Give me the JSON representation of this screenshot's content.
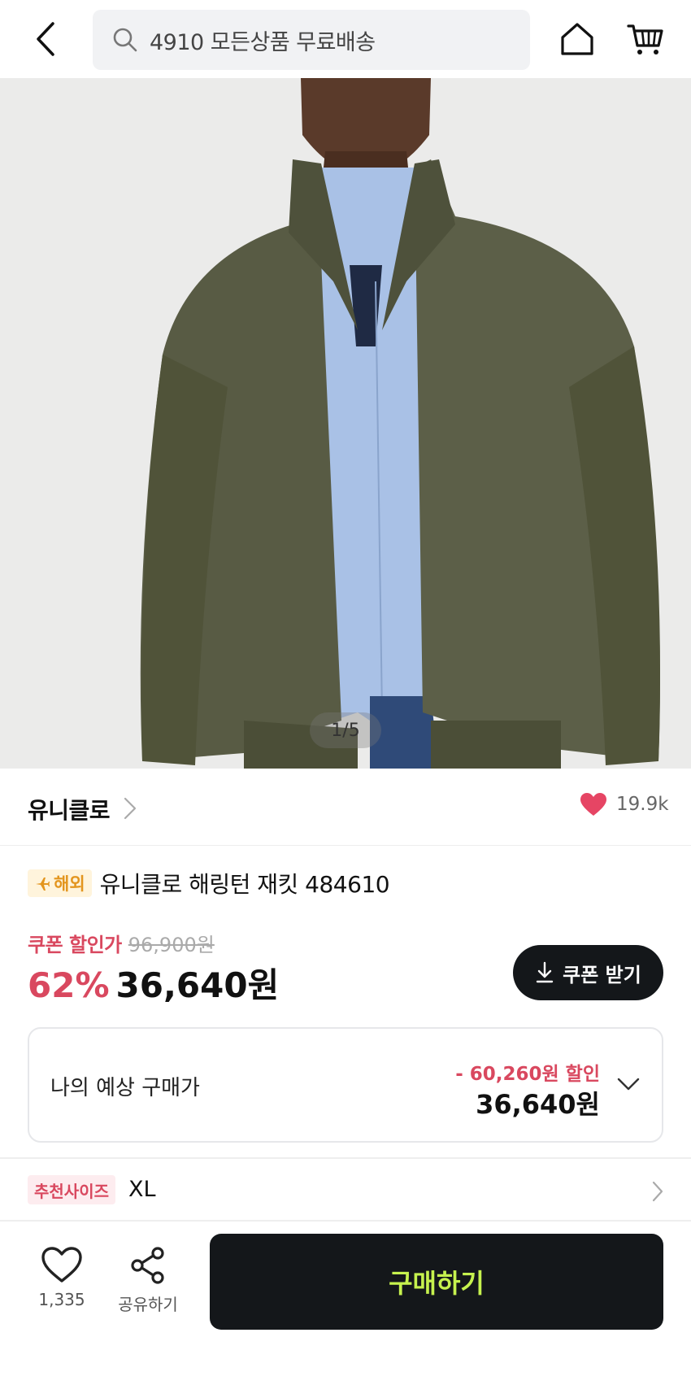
{
  "header": {
    "search_placeholder": "4910 모든상품 무료배송"
  },
  "gallery": {
    "counter": "1/5"
  },
  "brand": {
    "name": "유니클로",
    "likes": "19.9k"
  },
  "product": {
    "badge": "해외",
    "title": "유니클로 해링턴 재킷 484610"
  },
  "price": {
    "coupon_label": "쿠폰 할인가",
    "original_price": "96,900원",
    "discount_rate": "62%",
    "sale_price": "36,640원",
    "coupon_button": "쿠폰 받기"
  },
  "expected": {
    "label": "나의 예상 구매가",
    "discount": "- 60,260원 할인",
    "price": "36,640원"
  },
  "size": {
    "badge": "추천사이즈",
    "value": "XL"
  },
  "bottom": {
    "wish_count": "1,335",
    "share_label": "공유하기",
    "buy_label": "구매하기"
  },
  "colors": {
    "accent_red": "#d9485f",
    "buy_button_bg": "#14171a",
    "buy_button_text": "#c6f24e",
    "overseas_badge": "#e3951e"
  },
  "icons": [
    "back-arrow-icon",
    "search-icon",
    "home-icon",
    "cart-icon",
    "chevron-right-icon",
    "heart-filled-icon",
    "plane-icon",
    "download-icon",
    "chevron-down-icon",
    "heart-outline-icon",
    "share-icon"
  ]
}
